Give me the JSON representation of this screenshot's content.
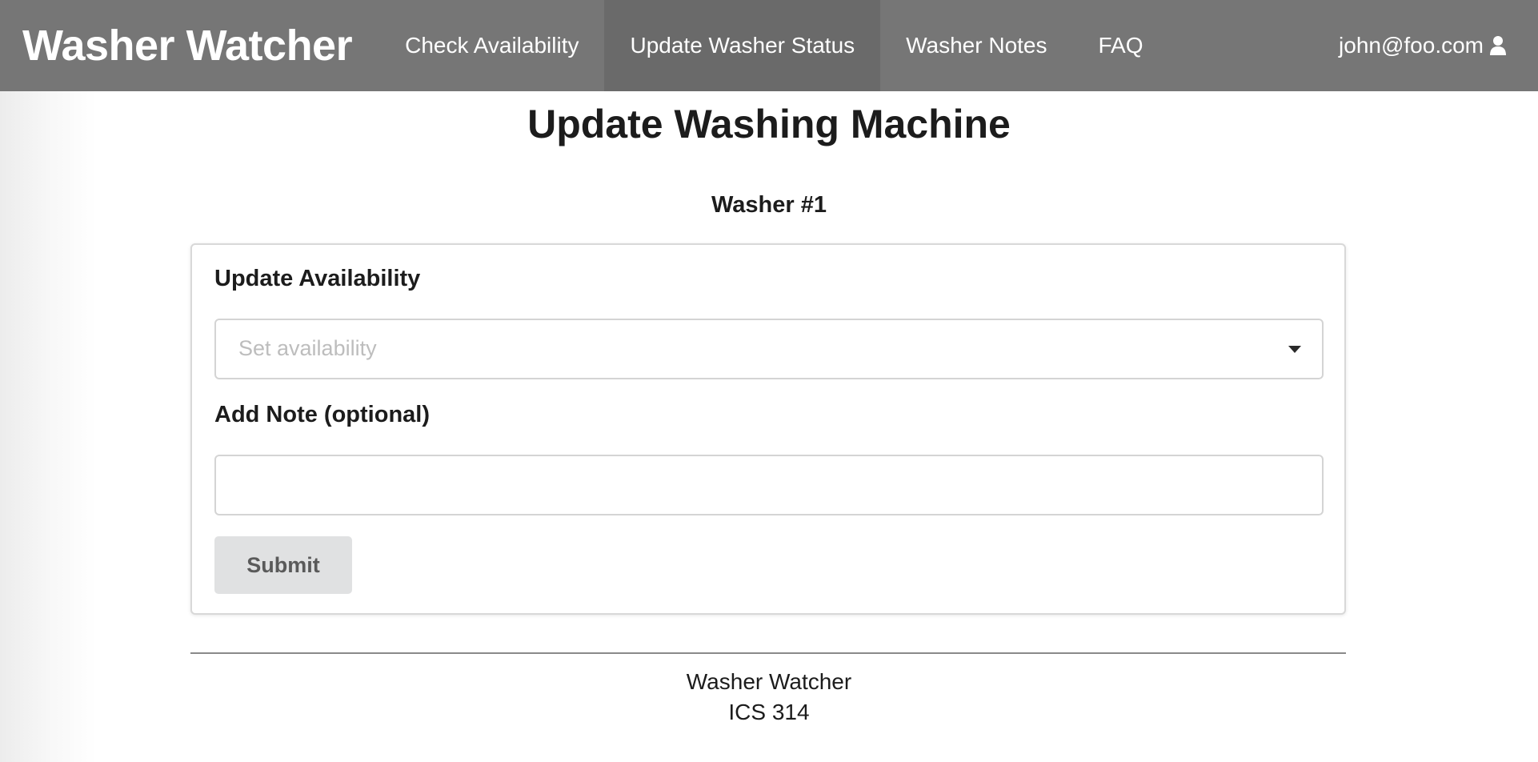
{
  "navbar": {
    "brand": "Washer Watcher",
    "items": [
      {
        "label": "Check Availability",
        "active": false
      },
      {
        "label": "Update Washer Status",
        "active": true
      },
      {
        "label": "Washer Notes",
        "active": false
      },
      {
        "label": "FAQ",
        "active": false
      }
    ],
    "user": {
      "email": "john@foo.com",
      "icon": "user-icon"
    },
    "background_color": "#767676"
  },
  "main": {
    "title": "Update Washing Machine",
    "washer_name": "Washer #1",
    "form": {
      "availability_label": "Update Availability",
      "availability_placeholder": "Set availability",
      "availability_value": "",
      "note_label": "Add Note (optional)",
      "note_value": "",
      "submit_label": "Submit"
    }
  },
  "footer": {
    "line1": "Washer Watcher",
    "line2": "ICS 314"
  }
}
